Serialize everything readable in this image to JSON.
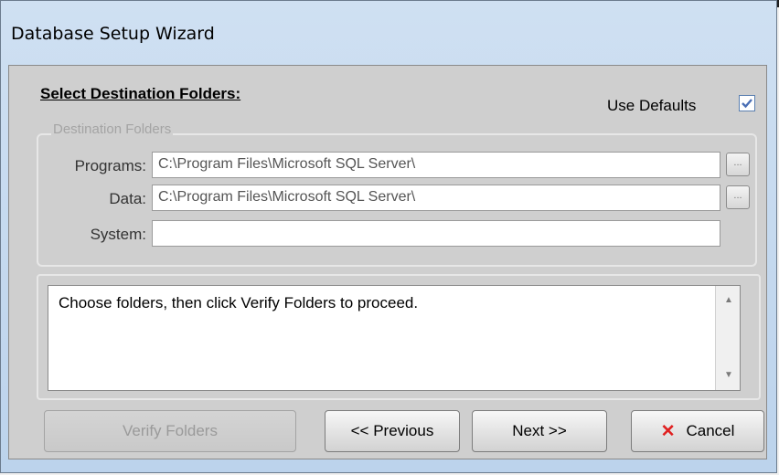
{
  "window": {
    "title": "Database Setup Wizard"
  },
  "section": {
    "heading": "Select Destination Folders:"
  },
  "use_defaults": {
    "label": "Use Defaults",
    "checked": true
  },
  "destination_group": {
    "legend": "Destination Folders",
    "fields": [
      {
        "label": "Programs:",
        "value": "C:\\Program Files\\Microsoft SQL Server\\",
        "browse": "..."
      },
      {
        "label": "Data:",
        "value": "C:\\Program Files\\Microsoft SQL Server\\",
        "browse": "..."
      },
      {
        "label": "System:",
        "value": ""
      }
    ]
  },
  "message": {
    "text": "Choose folders, then click Verify Folders to proceed."
  },
  "buttons": {
    "verify": "Verify Folders",
    "previous": "<< Previous",
    "next": "Next >>",
    "cancel": "Cancel"
  },
  "icons": {
    "cancel": "close-x-icon",
    "check": "checkmark-icon"
  },
  "colors": {
    "accent": "#4a6fb5",
    "cancel_x": "#e02020"
  }
}
